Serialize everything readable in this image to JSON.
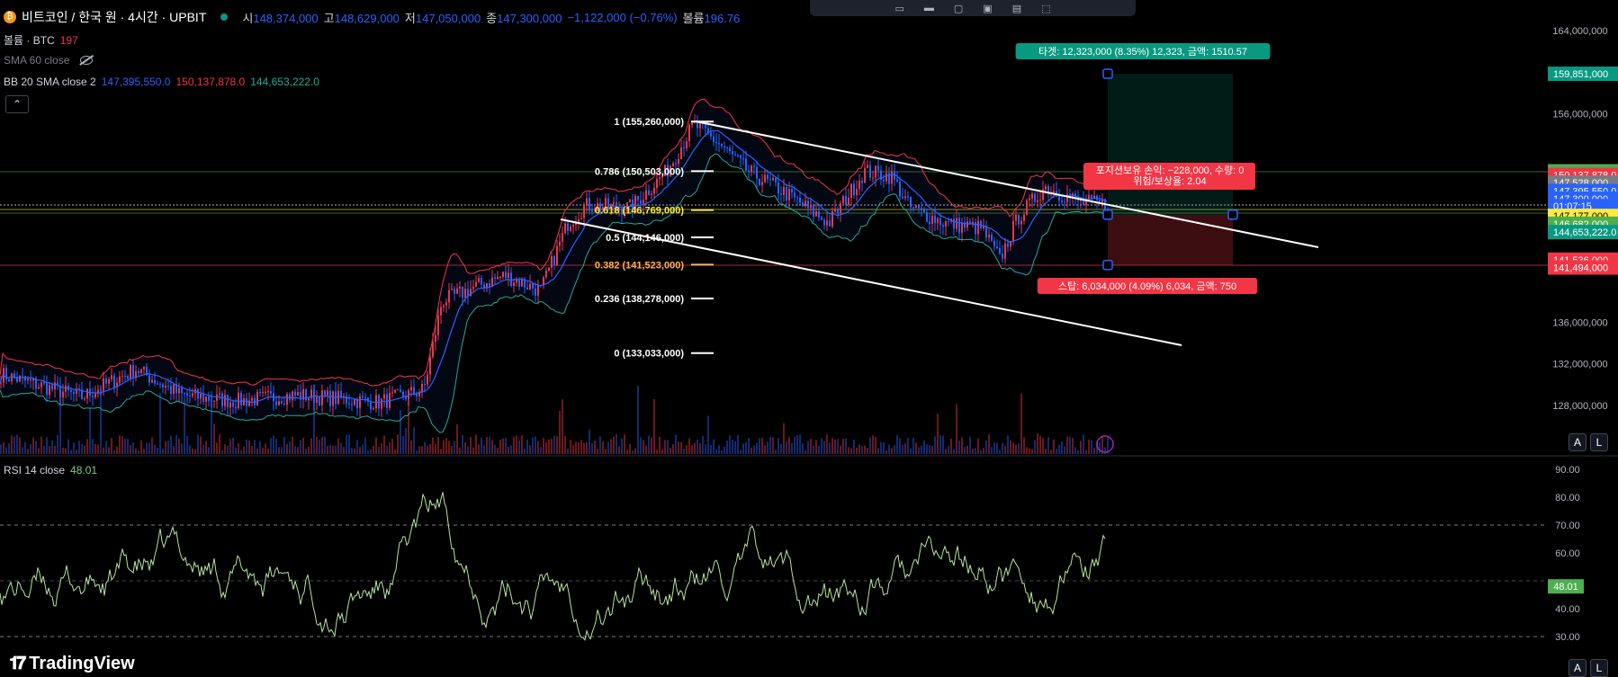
{
  "header": {
    "symbol": "비트코인 / 한국 원 · 4시간 · UPBIT",
    "o_label": "시",
    "o_value": "148,374,000",
    "h_label": "고",
    "h_value": "148,629,000",
    "l_label": "저",
    "l_value": "147,050,000",
    "c_label": "종",
    "c_value": "147,300,000",
    "change": "−1,122,000 (−0.76%)",
    "vol_label": "볼륨",
    "vol_value": "196.76"
  },
  "indicators": {
    "volume_label": "볼륨 · BTC",
    "volume_value": "197",
    "sma_label": "SMA 60 close",
    "bb_label": "BB 20 SMA close 2",
    "bb_basis": "147,395,550.0",
    "bb_upper": "150,137,878.0",
    "bb_lower": "144,653,222.0",
    "rsi_label": "RSI 14 close",
    "rsi_value": "48.01"
  },
  "price_axis": {
    "ticks": [
      "164,000,000",
      "156,000,000",
      "136,000,000",
      "132,000,000",
      "128,000,000"
    ],
    "badges": [
      {
        "text": "159,851,000",
        "color": "#089981",
        "price": 159851000
      },
      {
        "text": "150,486,000",
        "color": "#4caf50",
        "price": 150486000
      },
      {
        "text": "150,137,878.0",
        "color": "#f23645",
        "price": 150137878
      },
      {
        "text": "147,528,000",
        "color": "#787b86",
        "price": 149400000
      },
      {
        "text": "147,395,550.0",
        "color": "#2962ff",
        "price": 148600000
      },
      {
        "text": "147,300,000",
        "color": "#2962ff",
        "price": 147850000
      },
      {
        "text": "01:07:15",
        "color": "#2962ff",
        "price": 147150000
      },
      {
        "text": "147,177,000",
        "color": "#ffeb3b",
        "price": 146200000
      },
      {
        "text": "146,682,000",
        "color": "#4caf50",
        "price": 145450000
      },
      {
        "text": "144,653,222.0",
        "color": "#089981",
        "price": 144653222
      },
      {
        "text": "141,536,000",
        "color": "#f23645",
        "price": 142000000
      },
      {
        "text": "141,494,000",
        "color": "#f23645",
        "price": 141250000
      }
    ]
  },
  "rsi_axis": {
    "ticks": [
      "90.00",
      "80.00",
      "70.00",
      "60.00",
      "40.00",
      "30.00"
    ]
  },
  "fib": [
    {
      "label": "1 (155,260,000)",
      "color": "#ffffff",
      "price": 155260000
    },
    {
      "label": "0.786 (150,503,000)",
      "color": "#ffffff",
      "price": 150503000
    },
    {
      "label": "0.618 (146,769,000)",
      "color": "#ffeb3b",
      "price": 146769000
    },
    {
      "label": "0.5 (144,146,000)",
      "color": "#ffffff",
      "price": 144146000
    },
    {
      "label": "0.382 (141,523,000)",
      "color": "#ffb74d",
      "price": 141523000
    },
    {
      "label": "0.236 (138,278,000)",
      "color": "#ffffff",
      "price": 138278000
    },
    {
      "label": "0 (133,033,000)",
      "color": "#ffffff",
      "price": 133033000
    }
  ],
  "position": {
    "target_label": "타겟: 12,323,000 (8.35%) 12,323, 금액: 1510.57",
    "stop_label": "스탑: 6,034,000 (4.09%) 6,034, 금액: 750",
    "info_line1": "포지션보유 손익: −228,000, 수량: 0",
    "info_line2": "위험/보상율: 2.04",
    "entry": 147528000,
    "target": 159851000,
    "stop": 141494000
  },
  "colors": {
    "bg": "#000000",
    "up": "#f23645",
    "down": "#2962ff",
    "bb_upper": "#f23645",
    "bb_basis": "#2962ff",
    "bb_lower": "#22ab94",
    "rsi": "#b7e4a1",
    "target": "#089981",
    "stop": "#f23645"
  },
  "buttons": {
    "auto": "A",
    "log": "L"
  },
  "brand": {
    "name": "TradingView"
  }
}
